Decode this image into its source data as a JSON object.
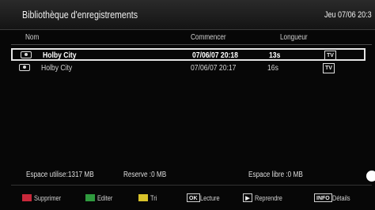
{
  "header": {
    "title": "Bibliothèque d'enregistrements",
    "datetime": "Jeu 07/06 20:3"
  },
  "columns": {
    "name": "Nom",
    "start": "Commencer",
    "length": "Longueur"
  },
  "recordings": [
    {
      "name": "Holby City",
      "start": "07/06/07  20:18",
      "length": "13s",
      "badge": "TV",
      "selected": true
    },
    {
      "name": "Holby City",
      "start": "07/06/07  20:17",
      "length": "16s",
      "badge": "TV",
      "selected": false
    }
  ],
  "status": {
    "used": "Espace utilise:1317 MB",
    "reserved": "Reserve :0 MB",
    "free": "Espace libre :0 MB"
  },
  "footer": {
    "keys": [
      {
        "label": "Supprimer",
        "color": "#c8283a"
      },
      {
        "label": "Editer",
        "color": "#2f9a3e"
      },
      {
        "label": "Tri",
        "color": "#d8c22a"
      },
      {
        "key": "OK",
        "label": "Lecture"
      },
      {
        "key": "▶",
        "label": "Reprendre"
      },
      {
        "key": "INFO",
        "label": "Détails"
      }
    ]
  }
}
